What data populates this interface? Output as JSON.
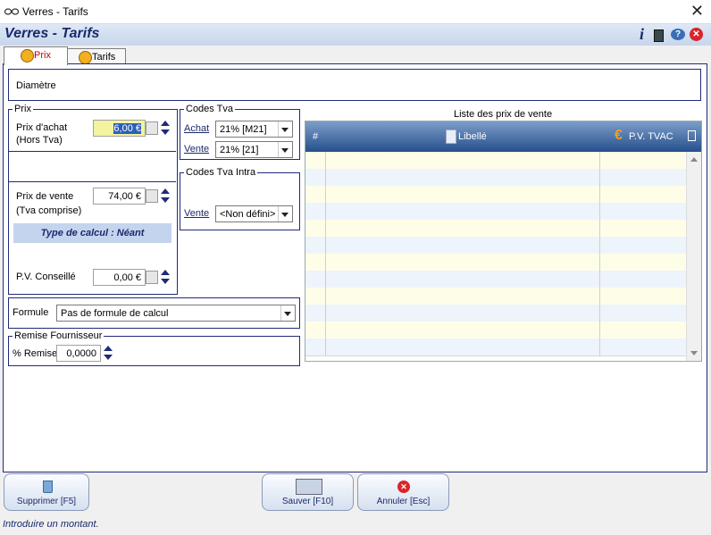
{
  "window": {
    "title": "Verres - Tarifs"
  },
  "header": {
    "title": "Verres - Tarifs"
  },
  "tabs": [
    {
      "label": "Prix",
      "active": true
    },
    {
      "label": "Tarifs",
      "active": false
    }
  ],
  "diametre": {
    "label": "Diamètre"
  },
  "prix": {
    "legend": "Prix",
    "achat_label_1": "Prix d'achat",
    "achat_label_2": "(Hors Tva)",
    "achat_value": "6,00 €",
    "vente_label_1": "Prix de vente",
    "vente_label_2": "(Tva comprise)",
    "vente_value": "74,00 €",
    "type_calcul": "Type de calcul :  Néant",
    "pv_conseille_label": "P.V. Conseillé",
    "pv_conseille_value": "0,00 €"
  },
  "codes_tva": {
    "legend": "Codes Tva",
    "achat_label": "Achat",
    "achat_value": "21% [M21]",
    "vente_label": "Vente",
    "vente_value": "21% [21]"
  },
  "codes_tva_intra": {
    "legend": "Codes Tva Intra",
    "vente_label": "Vente",
    "vente_value": "<Non défini>"
  },
  "formule": {
    "label": "Formule",
    "value": "Pas de formule de calcul"
  },
  "remise": {
    "legend": "Remise Fournisseur",
    "label": "% Remise",
    "value": "0,0000"
  },
  "liste": {
    "title": "Liste des prix de vente",
    "columns": [
      "#",
      "Libellé",
      "P.V. TVAC"
    ],
    "row_count": 12
  },
  "buttons": {
    "supprimer": "Supprimer [F5]",
    "sauver": "Sauver [F10]",
    "annuler": "Annuler [Esc]"
  },
  "status": {
    "text": "Introduire un montant."
  },
  "colors": {
    "accent": "#1a2a6c",
    "highlight": "#f3f3a0",
    "grid_header": "#254f8c"
  }
}
